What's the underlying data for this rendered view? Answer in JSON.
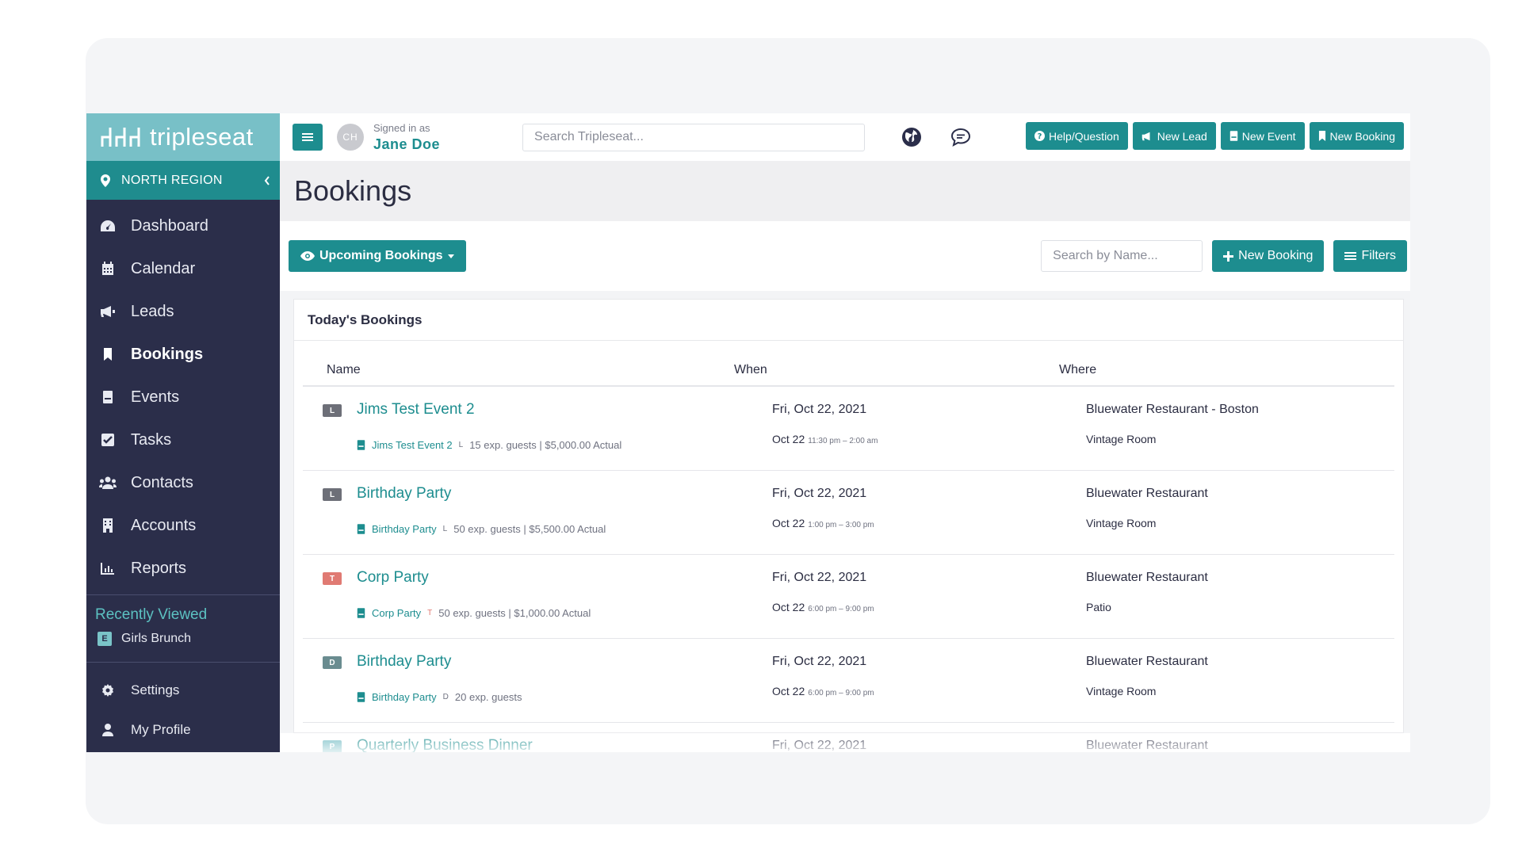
{
  "app": {
    "logo_text": "tripleseat",
    "region": "NORTH REGION"
  },
  "sidebar": {
    "items": [
      {
        "label": "Dashboard",
        "icon": "dashboard-icon"
      },
      {
        "label": "Calendar",
        "icon": "calendar-icon"
      },
      {
        "label": "Leads",
        "icon": "megaphone-icon"
      },
      {
        "label": "Bookings",
        "icon": "bookmark-icon",
        "active": true
      },
      {
        "label": "Events",
        "icon": "document-icon"
      },
      {
        "label": "Tasks",
        "icon": "checkbox-icon"
      },
      {
        "label": "Contacts",
        "icon": "users-icon"
      },
      {
        "label": "Accounts",
        "icon": "building-icon"
      },
      {
        "label": "Reports",
        "icon": "chart-icon"
      }
    ],
    "recent_title": "Recently Viewed",
    "recent_items": [
      {
        "badge": "E",
        "label": "Girls Brunch"
      }
    ],
    "footer": [
      {
        "label": "Settings",
        "icon": "gear-icon"
      },
      {
        "label": "My Profile",
        "icon": "user-icon"
      }
    ]
  },
  "topbar": {
    "avatar_initials": "CH",
    "signed_in_label": "Signed in as",
    "user_name": "Jane Doe",
    "search_placeholder": "Search Tripleseat...",
    "buttons": {
      "help": "Help/Question",
      "new_lead": "New Lead",
      "new_event": "New Event",
      "new_booking": "New Booking"
    }
  },
  "page": {
    "title": "Bookings",
    "filter_label": "Upcoming Bookings",
    "name_search_placeholder": "Search by Name...",
    "new_booking": "New Booking",
    "filters": "Filters"
  },
  "panel": {
    "title": "Today's Bookings",
    "columns": {
      "name": "Name",
      "when": "When",
      "where": "Where"
    },
    "rows": [
      {
        "badge": "L",
        "badge_color": "#6d6f78",
        "name": "Jims Test Event 2",
        "sub_link": "Jims Test Event 2",
        "sub_letter": "L",
        "sub_text": "15 exp. guests | $5,000.00 Actual",
        "day": "Fri, Oct 22, 2021",
        "date": "Oct 22",
        "time": "11:30 pm – 2:00 am",
        "location": "Bluewater Restaurant - Boston",
        "room": "Vintage Room"
      },
      {
        "badge": "L",
        "badge_color": "#6d6f78",
        "name": "Birthday Party",
        "sub_link": "Birthday Party",
        "sub_letter": "L",
        "sub_text": "50 exp. guests | $5,500.00 Actual",
        "day": "Fri, Oct 22, 2021",
        "date": "Oct 22",
        "time": "1:00 pm – 3:00 pm",
        "location": "Bluewater Restaurant",
        "room": "Vintage Room"
      },
      {
        "badge": "T",
        "badge_color": "#e07a73",
        "name": "Corp Party",
        "sub_link": "Corp Party",
        "sub_letter": "T",
        "sub_text": "50 exp. guests | $1,000.00 Actual",
        "day": "Fri, Oct 22, 2021",
        "date": "Oct 22",
        "time": "6:00 pm – 9:00 pm",
        "location": "Bluewater Restaurant",
        "room": "Patio"
      },
      {
        "badge": "D",
        "badge_color": "#6a8c90",
        "name": "Birthday Party",
        "sub_link": "Birthday Party",
        "sub_letter": "D",
        "sub_text": "20 exp. guests",
        "day": "Fri, Oct 22, 2021",
        "date": "Oct 22",
        "time": "6:00 pm – 9:00 pm",
        "location": "Bluewater Restaurant",
        "room": "Vintage Room"
      },
      {
        "badge": "P",
        "badge_color": "#6bb8c0",
        "name": "Quarterly Business Dinner",
        "sub_link": "",
        "sub_letter": "",
        "sub_text": "",
        "day": "Fri, Oct 22, 2021",
        "date": "",
        "time": "",
        "location": "Bluewater Restaurant",
        "room": ""
      }
    ]
  },
  "colors": {
    "teal": "#1d8d8f",
    "sidebar": "#2b2e4a",
    "logo_bg": "#78c0c7"
  }
}
